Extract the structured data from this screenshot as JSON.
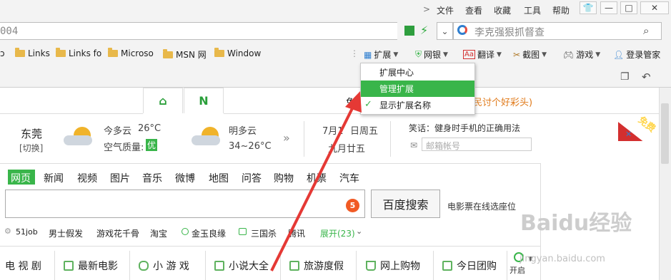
{
  "titlebar": {
    "menu": [
      "文件",
      "查看",
      "收藏",
      "工具",
      "帮助"
    ],
    "arrow": ">",
    "buttons": {
      "shirt": "👕",
      "minimize": "—",
      "maximize": "□",
      "close": "✕"
    }
  },
  "address": {
    "url_text": "004",
    "search_placeholder": "李克强狠抓督查"
  },
  "bookmarks": [
    "Links",
    "Links fo",
    "Microso",
    "MSN 网",
    "Window"
  ],
  "bookmark_left_stub": "ɔ",
  "extensions": {
    "items": [
      "扩展",
      "网银",
      "翻译",
      "截图",
      "游戏",
      "登录管家"
    ]
  },
  "dropdown": {
    "items": [
      "扩展中心",
      "管理扩展",
      "显示扩展名称"
    ],
    "active_index": 1,
    "checked_index": 2
  },
  "page": {
    "tabs": [
      "⌂",
      "N"
    ],
    "top_notice_prefix": "免",
    "top_notice_suffix": "股民讨个好彩头)",
    "city": "东莞",
    "switch": "[切换]",
    "weather_today": "今多云",
    "temp_today": "26°C",
    "air_label": "空气质量:",
    "air_value": "优",
    "weather_tomorrow": "明多云",
    "temp_tomorrow": "34~26°C",
    "date1": "7月1",
    "date1_suffix": "日周五",
    "date2": "九月廿五",
    "joke": "笑话：健身时手机的正确用法",
    "email_placeholder": "邮箱帐号",
    "corner_badge": "免费",
    "nav": [
      "网页",
      "新闻",
      "视频",
      "图片",
      "音乐",
      "微博",
      "地图",
      "问答",
      "购物",
      "机票",
      "汽车"
    ],
    "search_badge": "5",
    "search_button": "百度搜索",
    "movie_text": "电影票在线选座位",
    "hot_links": [
      "51job",
      "男士假发",
      "游戏花千骨",
      "淘宝",
      "金玉良缘",
      "三国杀",
      "腾讯",
      "展开(23)"
    ],
    "categories": [
      "电 视 剧",
      "最新电影",
      "小 游 戏",
      "小说大全",
      "旅游度假",
      "网上购物",
      "今日团购"
    ],
    "open_label": "开启",
    "watermark": "Baidu经验",
    "watermark_sub": "jingyan.baidu.com"
  },
  "colors": {
    "accent": "#39b54a",
    "arrow": "#e53935",
    "badge": "#f15a24",
    "brandred": "#d32f2f"
  }
}
